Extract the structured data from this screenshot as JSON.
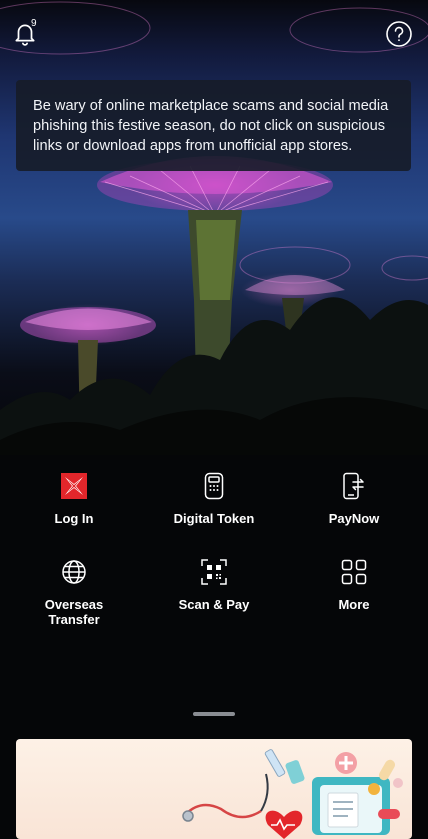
{
  "header": {
    "notification_icon": "bell-icon",
    "notification_count": "9",
    "help_icon": "question-circle-icon"
  },
  "notice": {
    "text": "Be wary of online marketplace scams and social media phishing this festive season, do not click on suspicious links or download apps from unofficial app stores."
  },
  "quick_actions": [
    {
      "label": "Log In",
      "icon": "dbs-logo-icon",
      "accent": "#e3262b"
    },
    {
      "label": "Digital Token",
      "icon": "token-device-icon"
    },
    {
      "label": "PayNow",
      "icon": "phone-transfer-icon"
    },
    {
      "label": "Overseas\nTransfer",
      "icon": "globe-icon"
    },
    {
      "label": "Scan & Pay",
      "icon": "qr-scan-icon"
    },
    {
      "label": "More",
      "icon": "grid-icon"
    }
  ],
  "colors": {
    "background": "#050608",
    "accent_red": "#e3262b",
    "notice_bg": "#161c28"
  }
}
